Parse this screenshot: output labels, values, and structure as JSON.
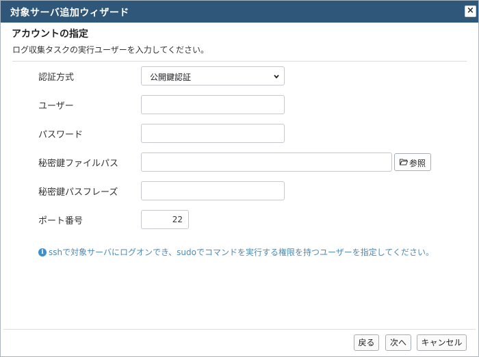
{
  "window": {
    "title": "対象サーバ追加ウィザード",
    "close_label": "×"
  },
  "section": {
    "title": "アカウントの指定",
    "description": "ログ収集タスクの実行ユーザーを入力してください。"
  },
  "form": {
    "auth_method": {
      "label": "認証方式",
      "value": "公開鍵認証"
    },
    "user": {
      "label": "ユーザー",
      "value": ""
    },
    "password": {
      "label": "パスワード",
      "value": ""
    },
    "private_key_path": {
      "label": "秘密鍵ファイルパス",
      "value": "",
      "browse_label": "参照"
    },
    "passphrase": {
      "label": "秘密鍵パスフレーズ",
      "value": ""
    },
    "port": {
      "label": "ポート番号",
      "value": "22"
    }
  },
  "info": {
    "icon": "info-icon",
    "text": "sshで対象サーバにログオンでき、sudoでコマンドを実行する権限を持つユーザーを指定してください。"
  },
  "footer": {
    "back_label": "戻る",
    "next_label": "次へ",
    "cancel_label": "キャンセル"
  }
}
